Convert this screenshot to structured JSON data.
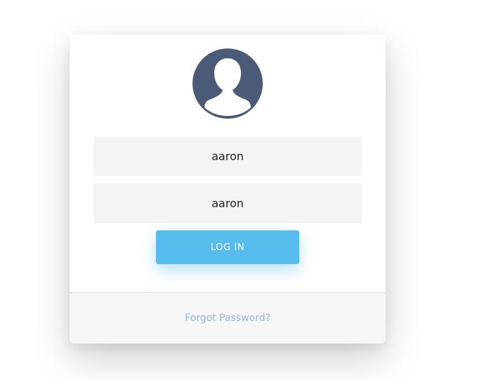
{
  "login_form": {
    "avatar_icon": "user-silhouette-icon",
    "username_value": "aaron",
    "password_value": "aaron",
    "login_button_label": "LOG IN",
    "forgot_password_label": "Forgot Password?"
  },
  "colors": {
    "avatar_background": "#4a5a77",
    "input_background": "#f4f4f4",
    "button_background": "#56bbed",
    "link_color": "#92b6d6",
    "footer_background": "#f6f6f6"
  }
}
